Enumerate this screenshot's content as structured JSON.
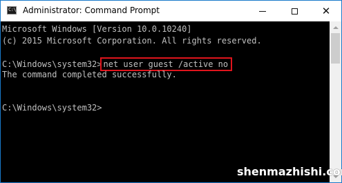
{
  "window": {
    "title": "Administrator: Command Prompt",
    "icon": "cmd-app-icon",
    "icon_label": "C:\\"
  },
  "controls": {
    "minimize": "minimize-icon",
    "maximize": "maximize-icon",
    "close_glyph": "✕"
  },
  "console": {
    "lines": [
      "Microsoft Windows [Version 10.0.10240]",
      "(c) 2015 Microsoft Corporation. All rights reserved.",
      "",
      "C:\\Windows\\system32>",
      "The command completed successfully.",
      "",
      "C:\\Windows\\system32>"
    ],
    "highlighted_command": "net user guest /active no",
    "highlight_color": "#e0141c",
    "text_color": "#c0c0c0",
    "background": "#000000"
  },
  "watermark": "shenmazhishi.com"
}
